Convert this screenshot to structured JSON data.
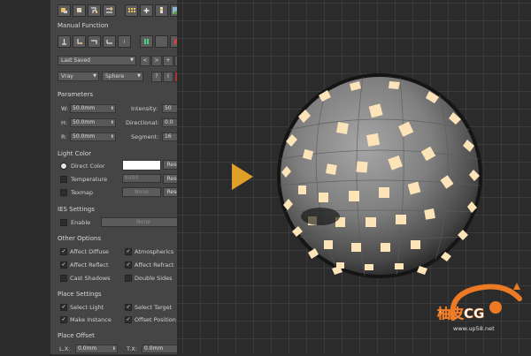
{
  "manual_function": {
    "title": "Manual Function"
  },
  "preset": {
    "selected": "Last Saved",
    "buttons": [
      "<",
      ">",
      "+",
      "−"
    ]
  },
  "renderer": {
    "selected": "Vray",
    "shape": "Sphere",
    "buttons": [
      "?",
      "I",
      "A"
    ]
  },
  "parameters": {
    "title": "Parameters",
    "w_label": "W:",
    "w_value": "50.0mm",
    "h_label": "H:",
    "h_value": "50.0mm",
    "r_label": "R:",
    "r_value": "50.0mm",
    "intensity_label": "Intensity:",
    "intensity_value": "50",
    "directional_label": "Directional:",
    "directional_value": "0.0",
    "segment_label": "Segment:",
    "segment_value": "16"
  },
  "light_color": {
    "title": "Light Color",
    "direct_color_label": "Direct Color",
    "direct_color_value": "#ffffff",
    "temperature_label": "Temperature",
    "temperature_value": "6500",
    "texmap_label": "Texmap",
    "texmap_value": "None",
    "reset_label": "Reset"
  },
  "ies_settings": {
    "title": "IES Settings",
    "enable_label": "Enable",
    "file_label": "None"
  },
  "other_options": {
    "title": "Other Options",
    "affect_diffuse": "Affect Diffuse",
    "atmospherics": "Atmospherics",
    "affect_reflect": "Affect Reflect",
    "affect_refract": "Affect Refract",
    "cast_shadows": "Cast Shadows",
    "double_sides": "Double Sides"
  },
  "place_settings": {
    "title": "Place Settings",
    "select_light": "Select Light",
    "select_target": "Select Target",
    "make_instance": "Make Instance",
    "offset_position": "Offset Position"
  },
  "place_offset": {
    "title": "Place Offset",
    "lx_label": "L.X:",
    "lx_value": "0.0mm",
    "tx_label": "T.X:",
    "tx_value": "0.0mm"
  },
  "colors": {
    "accent_arrow": "#e0a028",
    "tile_light": "#fde4b8",
    "panel_bg": "#454545",
    "logo_orange": "#ec7a24"
  },
  "watermark": {
    "brand": "柚皮CG",
    "url": "www.up58.net"
  }
}
